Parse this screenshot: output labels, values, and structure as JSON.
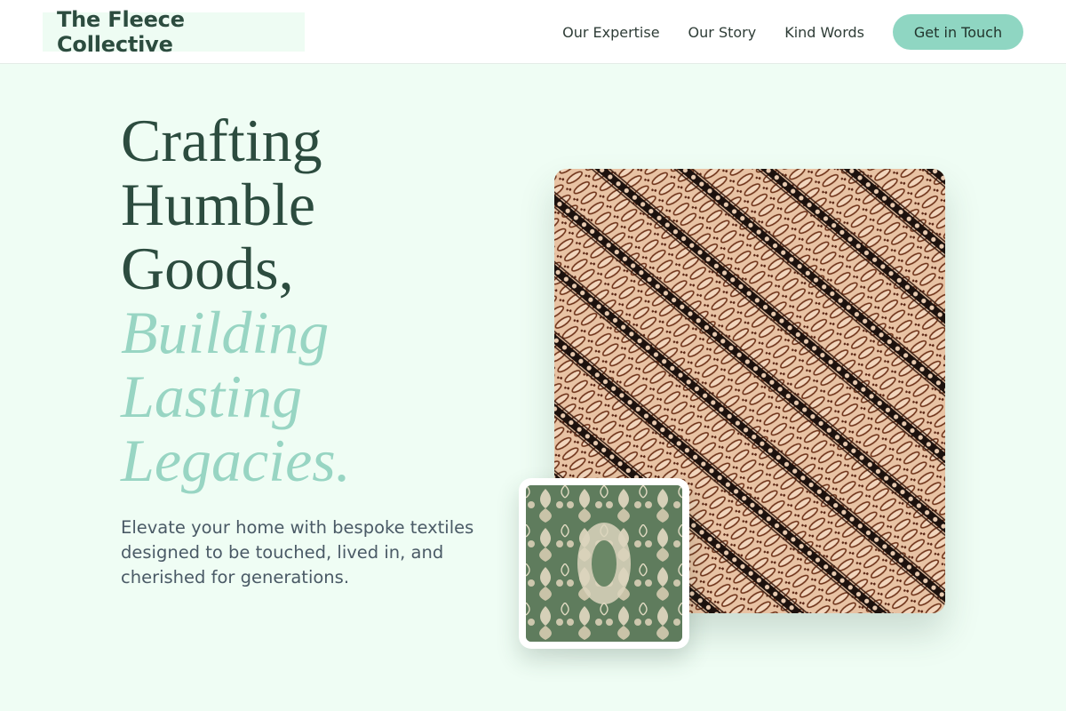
{
  "header": {
    "logo": "The Fleece Collective",
    "nav": [
      {
        "label": "Our Expertise"
      },
      {
        "label": "Our Story"
      },
      {
        "label": "Kind Words"
      }
    ],
    "cta_label": "Get in Touch",
    "accent_color": "#8fd6c2"
  },
  "hero": {
    "title_lines": [
      "Crafting",
      "Humble",
      "Goods,"
    ],
    "accent_lines": [
      "Building",
      "Lasting",
      "Legacies."
    ],
    "subtitle": "Elevate your home with bespoke textiles designed to be touched, lived in, and cherished for generations.",
    "title_color": "#2c4c3f",
    "accent_color": "#98d5c3"
  },
  "images": {
    "main": {
      "icon": "batik-textile-image"
    },
    "inset": {
      "icon": "damask-textile-image"
    }
  }
}
